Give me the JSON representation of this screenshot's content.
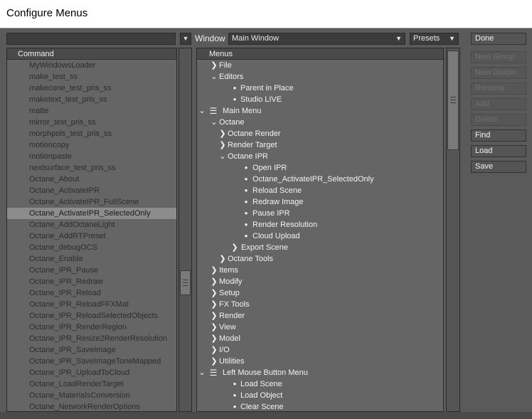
{
  "window": {
    "title": "Configure Menus"
  },
  "toolbar": {
    "window_label": "Window",
    "window_value": "Main Window",
    "presets_value": "Presets"
  },
  "command_list": {
    "header": "Command",
    "items": [
      "MyWindowsLoader",
      "make_test_ss",
      "makecone_test_pris_ss",
      "maketext_test_pris_ss",
      "matte",
      "mirror_test_pris_ss",
      "morphpols_test_pris_ss",
      "motioncopy",
      "motionpaste",
      "nextsurface_test_pris_ss",
      "Octane_About",
      "Octane_ActivateIPR",
      "Octane_ActivateIPR_FullScene",
      "Octane_ActivateIPR_SelectedOnly",
      "Octane_AddOctaneLight",
      "Octane_AddRTPreset",
      "Octane_debugOCS",
      "Octane_Enable",
      "Octane_IPR_Pause",
      "Octane_IPR_Redraw",
      "Octane_IPR_Reload",
      "Octane_IPR_ReloadFFXMat",
      "Octane_IPR_ReloadSelectedObjects",
      "Octane_IPR_RenderRegion",
      "Octane_IPR_Resize2RenderResolution",
      "Octane_IPR_SaveImage",
      "Octane_IPR_SaveImageToneMapped",
      "Octane_IPR_UploadToCloud",
      "Octane_LoadRenderTarget",
      "Octane_MaterialsConversion",
      "Octane_NetworkRenderOptions"
    ],
    "selected": "Octane_ActivateIPR_SelectedOnly"
  },
  "menu_tree": {
    "header": "Menus",
    "items": [
      {
        "label": "File",
        "kind": "collapsed",
        "depth": 0
      },
      {
        "label": "Editors",
        "kind": "expanded",
        "depth": 0
      },
      {
        "label": "Parent in Place",
        "kind": "item",
        "depth": 1
      },
      {
        "label": "Studio LIVE",
        "kind": "item",
        "depth": 1
      },
      {
        "label": "Main Menu",
        "kind": "root",
        "depth": 0
      },
      {
        "label": "Octane",
        "kind": "expanded",
        "depth": 0
      },
      {
        "label": "Octane Render",
        "kind": "collapsed",
        "depth": 1
      },
      {
        "label": "Render Target",
        "kind": "collapsed",
        "depth": 1
      },
      {
        "label": "Octane IPR",
        "kind": "expanded",
        "depth": 1
      },
      {
        "label": "Open IPR",
        "kind": "item",
        "depth": 3
      },
      {
        "label": "Octane_ActivateIPR_SelectedOnly",
        "kind": "item",
        "depth": 3
      },
      {
        "label": "Reload Scene",
        "kind": "item",
        "depth": 3
      },
      {
        "label": "Redraw Image",
        "kind": "item",
        "depth": 3
      },
      {
        "label": "Pause IPR",
        "kind": "item",
        "depth": 3
      },
      {
        "label": "Render Resolution",
        "kind": "item",
        "depth": 3
      },
      {
        "label": "Cloud Upload",
        "kind": "item",
        "depth": 3
      },
      {
        "label": "Export Scene",
        "kind": "collapsed",
        "depth": 2
      },
      {
        "label": "Octane Tools",
        "kind": "collapsed",
        "depth": 1
      },
      {
        "label": "Items",
        "kind": "collapsed",
        "depth": 0
      },
      {
        "label": "Modify",
        "kind": "collapsed",
        "depth": 0
      },
      {
        "label": "Setup",
        "kind": "collapsed",
        "depth": 0
      },
      {
        "label": "FX Tools",
        "kind": "collapsed",
        "depth": 0
      },
      {
        "label": "Render",
        "kind": "collapsed",
        "depth": 0
      },
      {
        "label": "View",
        "kind": "collapsed",
        "depth": 0
      },
      {
        "label": "Model",
        "kind": "collapsed",
        "depth": 0
      },
      {
        "label": "I/O",
        "kind": "collapsed",
        "depth": 0
      },
      {
        "label": "Utilities",
        "kind": "collapsed",
        "depth": 0
      },
      {
        "label": "Left Mouse Button Menu",
        "kind": "root",
        "depth": 0
      },
      {
        "label": "Load Scene",
        "kind": "item",
        "depth": 1
      },
      {
        "label": "Load Object",
        "kind": "item",
        "depth": 1
      },
      {
        "label": "Clear Scene",
        "kind": "item",
        "depth": 1
      }
    ]
  },
  "actions": {
    "done": "Done",
    "new_group": "New Group",
    "new_divider": "New Divider",
    "rename": "Rename",
    "add": "Add",
    "delete": "Delete",
    "find": "Find",
    "load": "Load",
    "save": "Save"
  },
  "icons": {
    "collapsed": "chevron-right-icon",
    "expanded": "chevron-down-icon",
    "item": "bullet-icon",
    "root": "menu-root-icon"
  }
}
